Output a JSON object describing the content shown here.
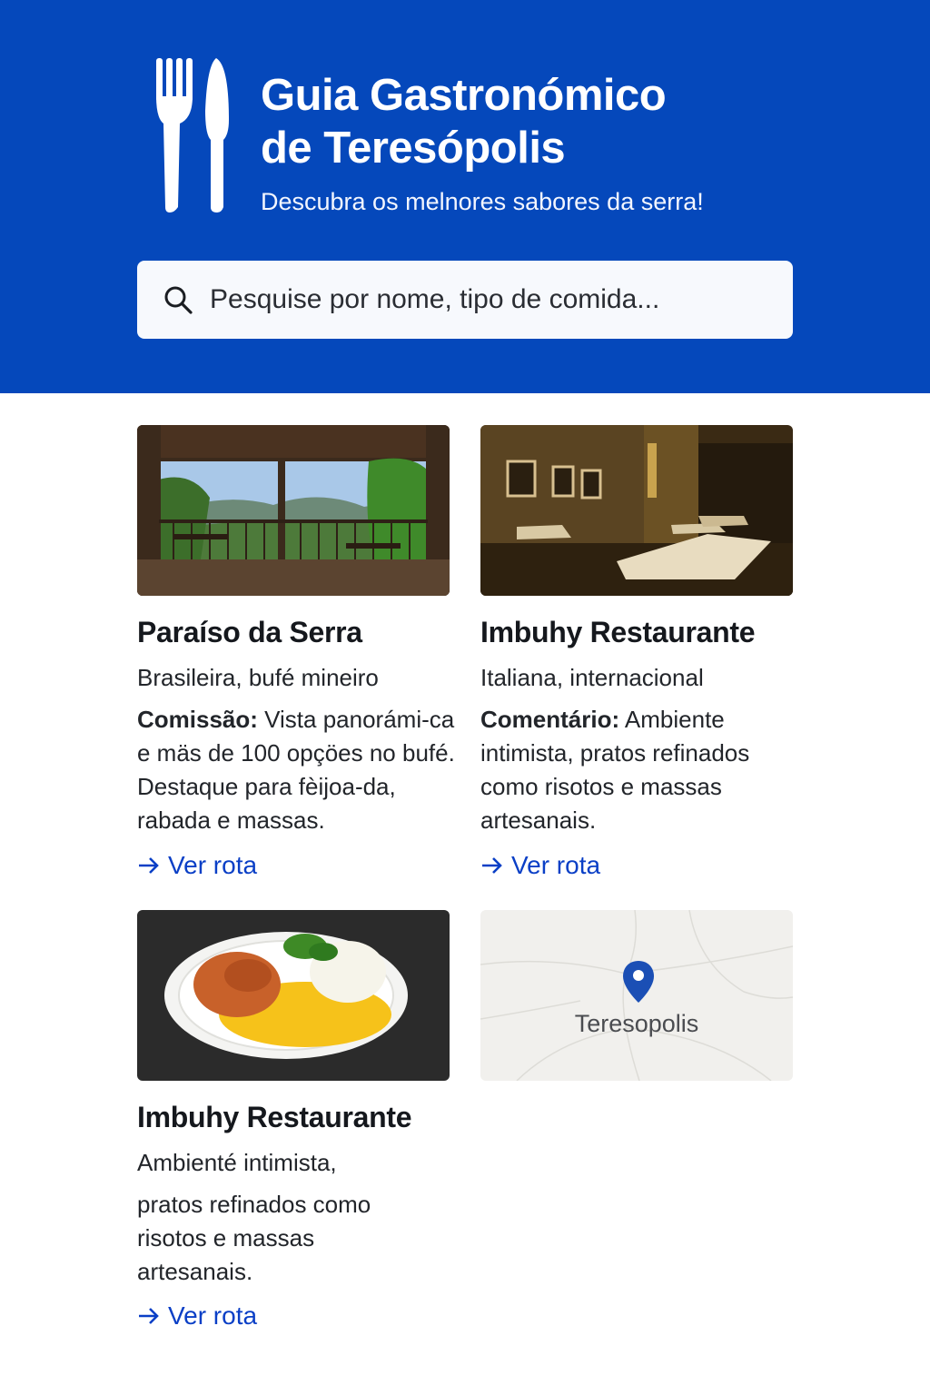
{
  "header": {
    "title_line1": "Guia Gastronómico",
    "title_line2": "de Teresópolis",
    "subtitle": "Descubra os melnores sabores da serra!",
    "logo_icon": "fork-knife-icon",
    "background": "#0548bb"
  },
  "search": {
    "placeholder": "Pesquise por nome, tipo de comida...",
    "value": "",
    "icon": "search-icon"
  },
  "cards": [
    {
      "name": "Paraíso da Serra",
      "cuisine": "Brasileira, bufé mineiro",
      "comment_label": "Comissão:",
      "comment": "Vista panorámi-ca e mäs de 100 opçöes no bufé. Destaque para fèijoa-da, rabada e massas.",
      "route": "Ver rota"
    },
    {
      "name": "Imbuhy Restaurante",
      "cuisine": "Italiana, internacional",
      "comment_label": "Comentário:",
      "comment": "Ambiente intimista, pratos refinados como risotos e massas artesanais.",
      "route": "Ver rota"
    },
    {
      "name": "Imbuhy Restaurante",
      "cuisine": "Ambienté intimista,",
      "comment": "pratos refinados como risotos e massas artesanais.",
      "route": "Ver rota"
    }
  ],
  "map": {
    "label": "Teresopolis",
    "icon": "map-pin-icon"
  },
  "colors": {
    "accent": "#0548bb",
    "link": "#0a3fc6",
    "text": "#15181d"
  }
}
